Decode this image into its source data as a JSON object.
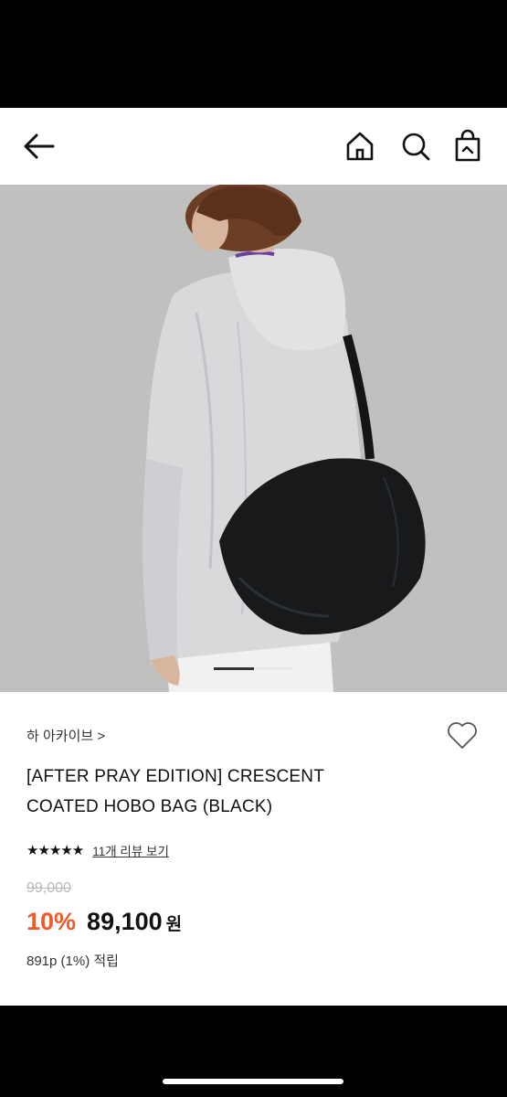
{
  "header": {
    "back_icon": "arrow-left-icon",
    "icons": [
      "home-icon",
      "search-icon",
      "shopping-bag-icon"
    ]
  },
  "hero": {
    "carousel_position": 1
  },
  "product": {
    "brand": "하 아카이브 >",
    "title_line1": "[AFTER PRAY EDITION] CRESCENT",
    "title_line2": "COATED HOBO BAG (BLACK)",
    "stars": "★★★★★",
    "rating": 5,
    "review_link": "11개 리뷰 보기",
    "original_price": "99,000",
    "discount": "10%",
    "sale_price": "89,100",
    "currency": "원",
    "points": "891p (1%) 적립"
  },
  "colors": {
    "accent": "#f05a28",
    "text": "#111111",
    "muted": "#b8b8b8"
  }
}
